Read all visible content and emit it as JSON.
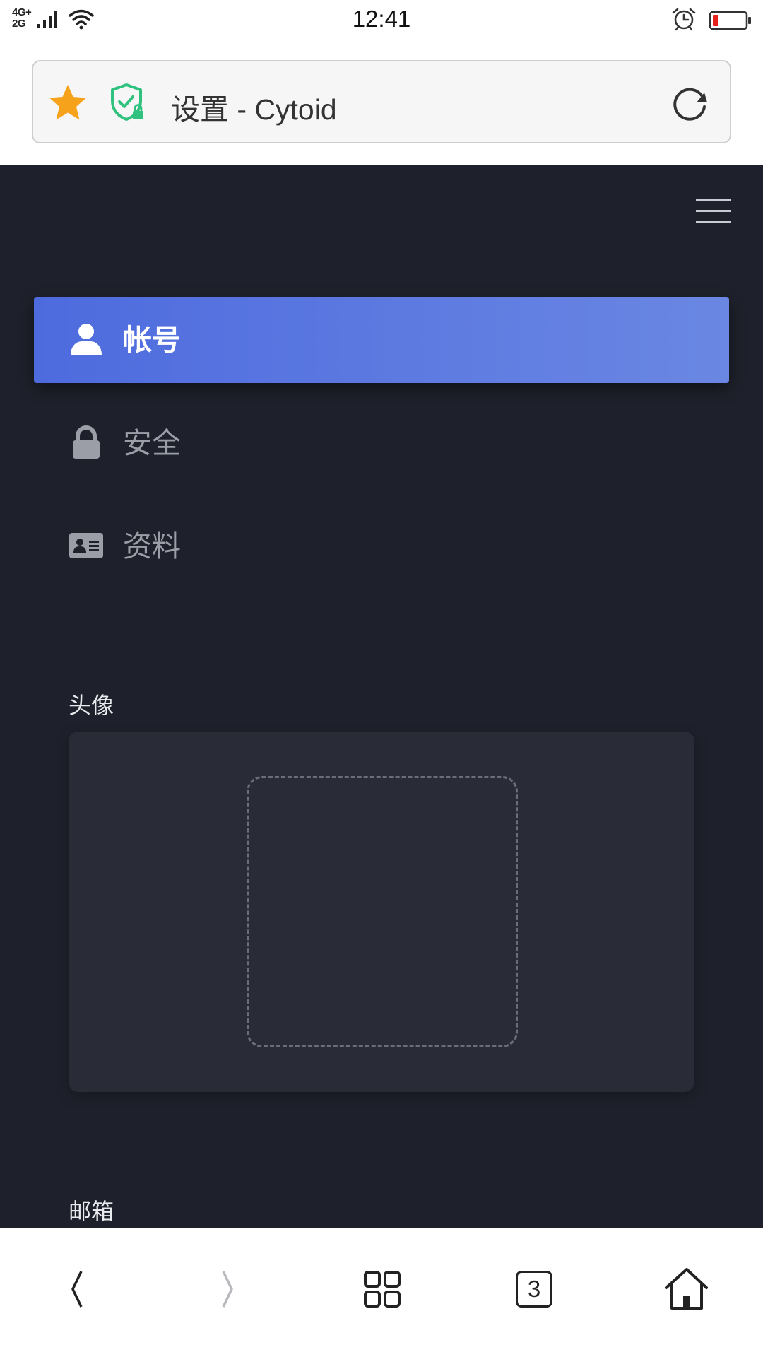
{
  "status_bar": {
    "network_top": "4G+",
    "network_bottom": "2G",
    "time": "12:41",
    "battery_color": "#e8201a"
  },
  "address_bar": {
    "title": "设置 - Cytoid",
    "star_color": "#f7a21b",
    "shield_color": "#2ec27e",
    "icons": [
      "star-icon",
      "shield-icon",
      "reload-icon"
    ]
  },
  "menu": {
    "icon": "hamburger-icon"
  },
  "settings_nav": {
    "active_gradient": [
      "#4e6bde",
      "#6a87e3"
    ],
    "items": [
      {
        "label": "帐号",
        "icon": "user-icon",
        "active": true
      },
      {
        "label": "安全",
        "icon": "lock-icon",
        "active": false
      },
      {
        "label": "资料",
        "icon": "id-card-icon",
        "active": false
      }
    ]
  },
  "form": {
    "avatar_label": "头像",
    "email_label": "邮箱"
  },
  "bottom_toolbar": {
    "icons": [
      "back-icon",
      "forward-icon",
      "apps-icon",
      "tabs-icon",
      "home-icon"
    ],
    "tab_count": "3"
  }
}
